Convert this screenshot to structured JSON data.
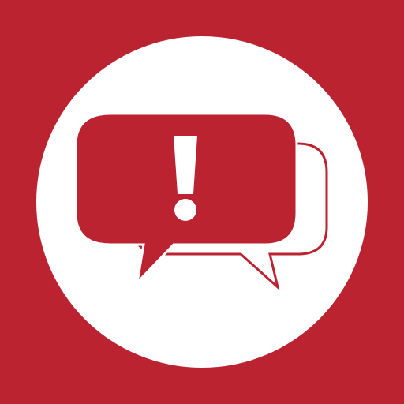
{
  "icon": {
    "name": "alert-chat-bubbles-icon",
    "description_glyph": "!",
    "colors": {
      "background": "#BB2330",
      "circle": "#FFFFFF",
      "bubble_fill": "#BB2330",
      "bubble_outline": "#BB2330",
      "exclamation": "#FFFFFF"
    }
  }
}
